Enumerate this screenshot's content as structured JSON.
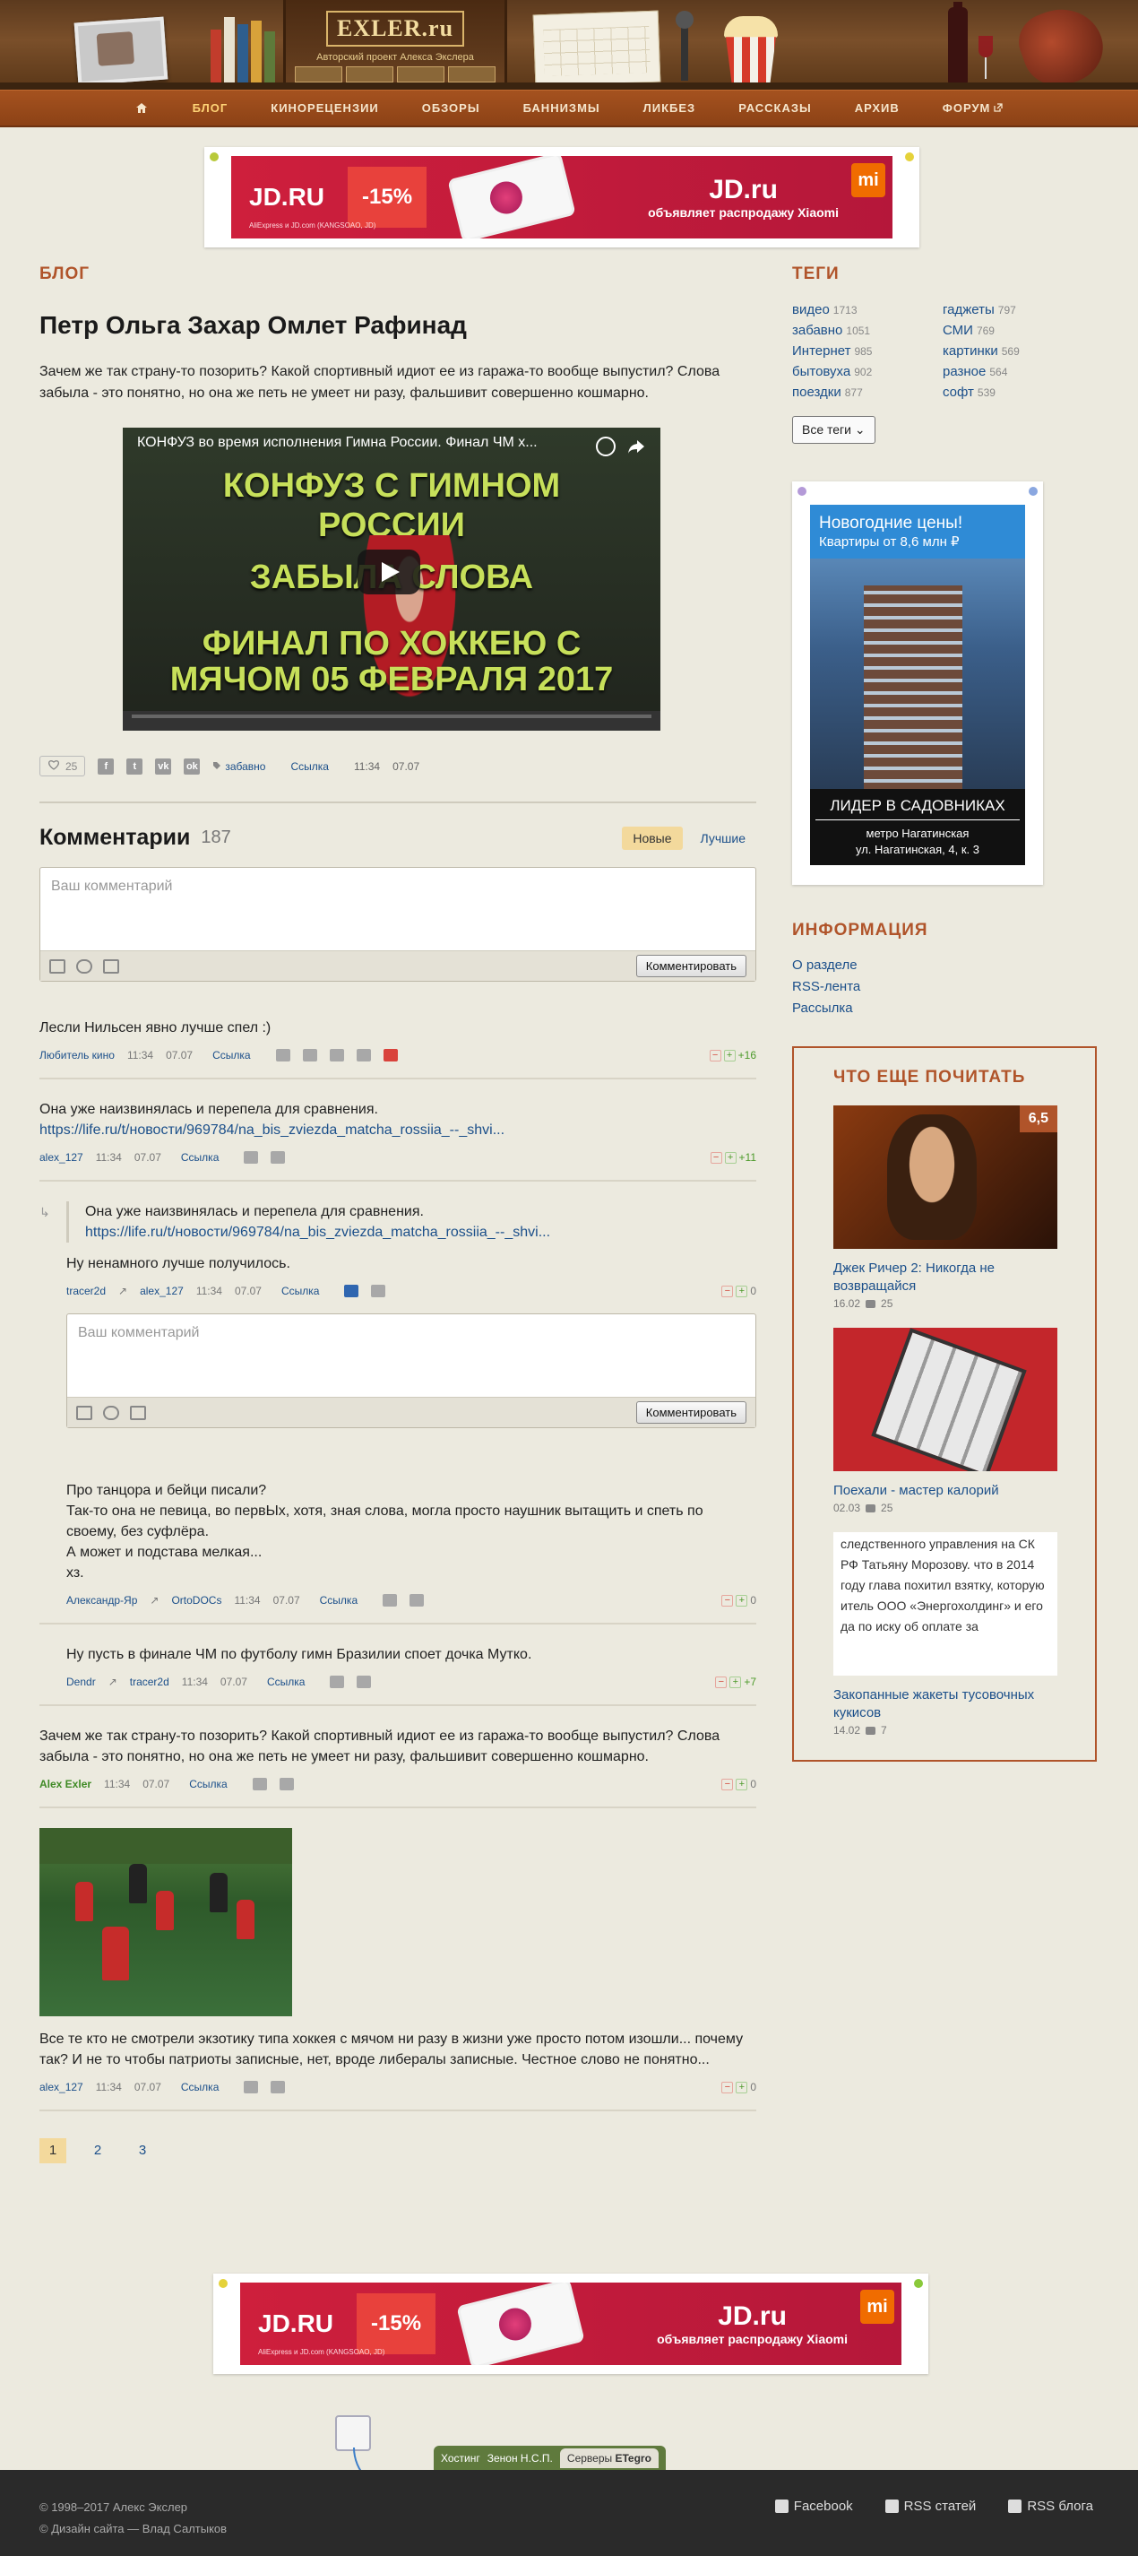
{
  "header": {
    "logo": "EXLER.ru",
    "tagline": "Авторский проект Алекса Экслера"
  },
  "nav": {
    "items": [
      "БЛОГ",
      "КИНОРЕЦЕНЗИИ",
      "ОБЗОРЫ",
      "БАННИЗМЫ",
      "ЛИКБЕЗ",
      "РАССКАЗЫ",
      "АРХИВ",
      "ФОРУМ"
    ],
    "active": "БЛОГ"
  },
  "ad": {
    "brand": "JD.RU",
    "discount": "-15%",
    "small_print": "AliExpress и JD.com (KANGSOAO, JD)",
    "right_title": "JD.ru",
    "right_text": "объявляет распродажу Xiaomi",
    "mi": "mi"
  },
  "post": {
    "section": "БЛОГ",
    "title": "Петр Ольга Захар Омлет Рафинад",
    "text": "Зачем же так страну-то позорить? Какой спортивный идиот ее из гаража-то вообще выпустил? Слова забыла - это понятно, но она же петь не умеет ни разу, фальшивит совершенно кошмарно.",
    "video_title": "КОНФУЗ во время исполнения Гимна России. Финал ЧМ х...",
    "video_line1": "КОНФУЗ С ГИМНОМ",
    "video_line2": "РОССИИ",
    "video_line3": "ЗАБЫЛА СЛОВА",
    "video_line4": "ФИНАЛ ПО ХОККЕЮ С",
    "video_line5": "МЯЧОМ 05 ФЕВРАЛЯ 2017",
    "likes": "25",
    "social": [
      "f",
      "t",
      "vk",
      "ok"
    ],
    "tag": "забавно",
    "link_label": "Ссылка",
    "time": "11:34",
    "date": "07.07"
  },
  "comments": {
    "title": "Комментарии",
    "count": "187",
    "sort_new": "Новые",
    "sort_best": "Лучшие",
    "placeholder": "Ваш комментарий",
    "submit": "Комментировать",
    "items": [
      {
        "text": "Лесли Нильсен явно лучше спел :)",
        "author": "Любитель кино",
        "time": "11:34",
        "date": "07.07",
        "link": "Ссылка",
        "score": "+16"
      },
      {
        "text": "Она уже наизвинялась и перепела для сравнения.",
        "url": "https://life.ru/t/новости/969784/na_bis_zviezda_matcha_rossiia_--_shvi...",
        "author": "alex_127",
        "time": "11:34",
        "date": "07.07",
        "link": "Ссылка",
        "score": "+11"
      },
      {
        "quote": "Она уже наизвинялась и перепела для сравнения.",
        "quote_url": "https://life.ru/t/новости/969784/na_bis_zviezda_matcha_rossiia_--_shvi...",
        "text": "Ну ненамного лучше получилось.",
        "author": "tracer2d",
        "reply_to": "alex_127",
        "time": "11:34",
        "date": "07.07",
        "link": "Ссылка",
        "score": "0"
      },
      {
        "line1": "Про танцора и бейци писали?",
        "line2": "Так-то она не певица, во первЫх, хотя, зная слова, могла просто наушник вытащить и спеть по своему, без суфлёра.",
        "line3": "А может и подстава мелкая...",
        "line4": "хз.",
        "author": "Александр-Яр",
        "reply_to": "OrtoDOCs",
        "time": "11:34",
        "date": "07.07",
        "link": "Ссылка",
        "score": "0"
      },
      {
        "text": "Ну пусть в финале ЧМ по футболу гимн Бразилии споет дочка Мутко.",
        "author": "Dendr",
        "reply_to": "tracer2d",
        "time": "11:34",
        "date": "07.07",
        "link": "Ссылка",
        "score": "+7"
      },
      {
        "text": "Зачем же так страну-то позорить? Какой спортивный идиот ее из гаража-то вообще выпустил? Слова забыла - это понятно, но она же петь не умеет ни разу, фальшивит совершенно кошмарно.",
        "author": "Alex Exler",
        "time": "11:34",
        "date": "07.07",
        "link": "Ссылка",
        "score": "0"
      },
      {
        "text": "Все те кто не смотрели экзотику типа хоккея с мячом ни разу в жизни уже просто потом изошли... почему так? И не то чтобы патриоты записные, нет, вроде либералы записные. Честное слово не понятно...",
        "author": "alex_127",
        "time": "11:34",
        "date": "07.07",
        "link": "Ссылка",
        "score": "0"
      }
    ]
  },
  "pagination": [
    "1",
    "2",
    "3"
  ],
  "sidebar": {
    "tags_title": "ТЕГИ",
    "tags": [
      {
        "name": "видео",
        "count": "1713"
      },
      {
        "name": "гаджеты",
        "count": "797"
      },
      {
        "name": "забавно",
        "count": "1051"
      },
      {
        "name": "СМИ",
        "count": "769"
      },
      {
        "name": "Интернет",
        "count": "985"
      },
      {
        "name": "картинки",
        "count": "569"
      },
      {
        "name": "бытовуха",
        "count": "902"
      },
      {
        "name": "разное",
        "count": "564"
      },
      {
        "name": "поездки",
        "count": "877"
      },
      {
        "name": "софт",
        "count": "539"
      }
    ],
    "all_tags": "Все теги",
    "side_ad": {
      "title": "Новогодние цены!",
      "subtitle": "Квартиры от 8,6 млн ₽",
      "caption_big": "ЛИДЕР В САДОВНИКАХ",
      "caption_1": "метро Нагатинская",
      "caption_2": "ул. Нагатинская, 4, к. 3"
    },
    "info_title": "ИНФОРМАЦИЯ",
    "info_links": [
      "О разделе",
      "RSS-лента",
      "Рассылка"
    ],
    "more_title": "ЧТО ЕЩЕ ПОЧИТАТЬ",
    "more": [
      {
        "title": "Джек Ричер 2: Никогда не возвращайся",
        "date": "16.02",
        "comments": "25",
        "badge": "6,5"
      },
      {
        "title": "Поехали - мастер калорий",
        "date": "02.03",
        "comments": "25"
      },
      {
        "title": "Закопанные жакеты тусовочных кукисов",
        "date": "14.02",
        "comments": "7",
        "snippet": "следственного управления на СК РФ Татьяну Морозову. что в 2014 году глава похитил взятку, которую итель ООО «Энергохолдинг» и его да по иску об оплате за"
      }
    ]
  },
  "footer": {
    "hosting": "Хостинг",
    "host_name": "Зенон Н.С.П.",
    "servers": "Серверы",
    "servers_brand": "ETegro",
    "copyright": "© 1998–2017 Алекс Экслер",
    "design": "© Дизайн сайта — Влад Салтыков",
    "links": [
      "Facebook",
      "RSS статей",
      "RSS блога"
    ]
  }
}
